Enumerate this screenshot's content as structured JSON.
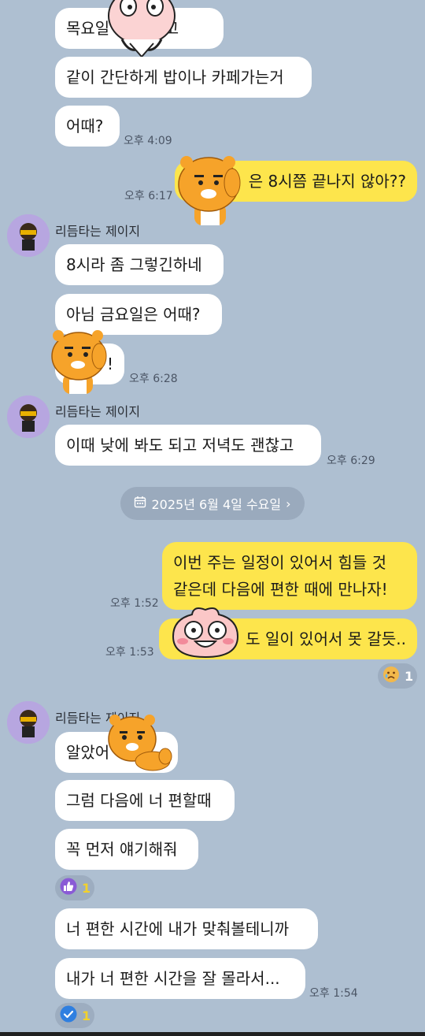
{
  "messages": [
    {
      "id": "m1",
      "text": "목요일 … 끝나고"
    },
    {
      "id": "m2",
      "text": "같이 간단하게 밥이나 카페가는거"
    },
    {
      "id": "m3",
      "text": "어때?",
      "time": "오후 4:09"
    },
    {
      "id": "m4",
      "text": "은 8시쯤 끝나지 않아??",
      "time": "오후 6:17"
    },
    {
      "id": "m5",
      "sender": "리듬타는 제이지",
      "text": "8시라 좀 그렇긴하네"
    },
    {
      "id": "m6",
      "text": "아님 금요일은 어때?"
    },
    {
      "id": "m7",
      "text": "!",
      "time": "오후 6:28"
    },
    {
      "id": "m8",
      "sender": "리듬타는 제이지",
      "text": "이때 낮에 봐도 되고 저녁도 괜찮고",
      "time": "오후 6:29"
    },
    {
      "id": "m9",
      "text_line1": "이번 주는 일정이 있어서 힘들 것",
      "text_line2": "같은데 다음에 편한 때에 만나자!",
      "time": "오후 1:52"
    },
    {
      "id": "m10",
      "text": "도 일이 있어서 못 갈듯..",
      "time": "오후 1:53"
    },
    {
      "id": "m11",
      "sender": "리듬타는 제이지",
      "text": "알았어"
    },
    {
      "id": "m12",
      "text": "그럼 다음에 너 편할때"
    },
    {
      "id": "m13",
      "text": "꼭 먼저 얘기해줘"
    },
    {
      "id": "m14",
      "text": "너 편한 시간에 내가 맞춰볼테니까"
    },
    {
      "id": "m15",
      "text": "내가 너 편한 시간을 잘 몰라서...",
      "time": "오후 1:54"
    }
  ],
  "date_divider": {
    "label": "2025년 6월 4일 수요일",
    "icon": "calendar-icon",
    "chevron": "›"
  },
  "reactions": {
    "sad": {
      "icon": "sad-face-icon",
      "count": "1"
    },
    "like": {
      "icon": "thumbs-up-icon",
      "count": "1"
    },
    "check": {
      "icon": "check-icon",
      "count": "1"
    }
  },
  "colors": {
    "background": "#aebfd1",
    "my_bubble": "#fde54c",
    "other_bubble": "#ffffff"
  }
}
